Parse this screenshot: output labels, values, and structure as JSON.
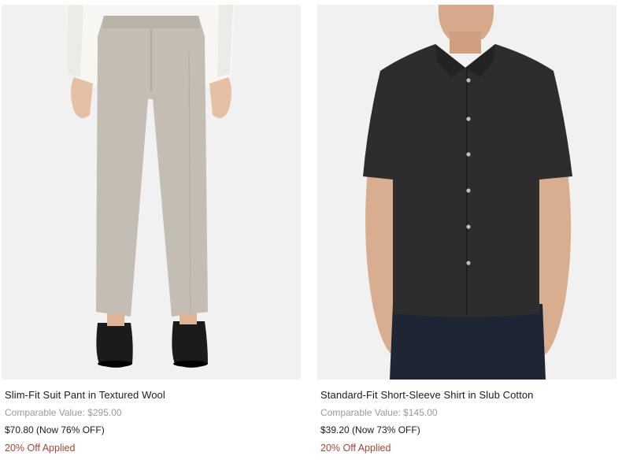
{
  "products": [
    {
      "name": "Slim-Fit Suit Pant in Textured Wool",
      "comparable": "Comparable Value: $295.00",
      "price": "$70.80 (Now 76% OFF)",
      "promo": "20% Off Applied",
      "image_icon": "trousers-photo"
    },
    {
      "name": "Standard-Fit Short-Sleeve Shirt in Slub Cotton",
      "comparable": "Comparable Value: $145.00",
      "price": "$39.20 (Now 73% OFF)",
      "promo": "20% Off Applied",
      "image_icon": "shirt-photo"
    }
  ],
  "colors": {
    "image_bg": "#f1f1f1",
    "promo": "#a8443a",
    "muted": "#9a9a9a",
    "text": "#1a1a1a"
  }
}
